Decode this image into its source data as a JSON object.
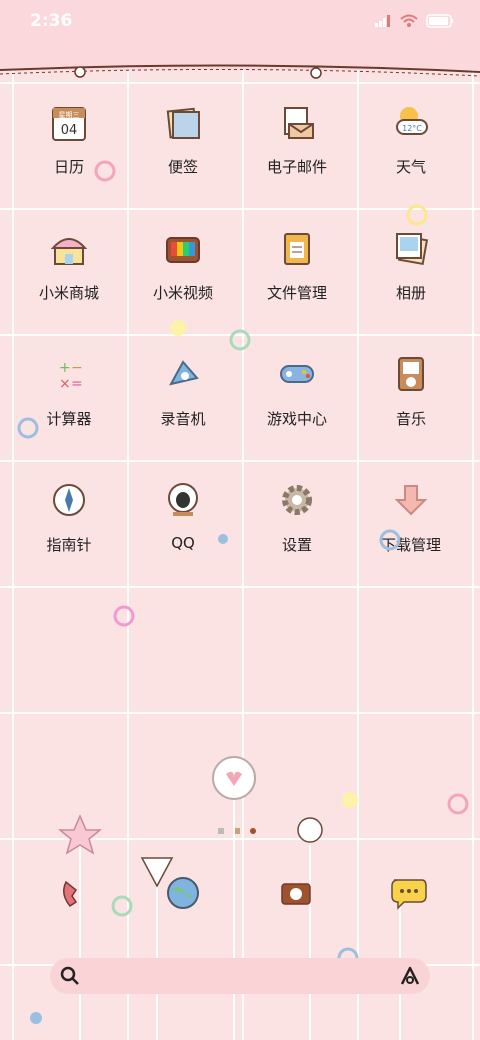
{
  "status": {
    "time": "2:36"
  },
  "apps": [
    [
      {
        "label": "日历",
        "icon": "calendar-icon"
      },
      {
        "label": "便签",
        "icon": "notes-icon"
      },
      {
        "label": "电子邮件",
        "icon": "email-icon"
      },
      {
        "label": "天气",
        "icon": "weather-icon"
      }
    ],
    [
      {
        "label": "小米商城",
        "icon": "mi-store-icon"
      },
      {
        "label": "小米视频",
        "icon": "mi-video-icon"
      },
      {
        "label": "文件管理",
        "icon": "file-manager-icon"
      },
      {
        "label": "相册",
        "icon": "gallery-icon"
      }
    ],
    [
      {
        "label": "计算器",
        "icon": "calculator-icon"
      },
      {
        "label": "录音机",
        "icon": "recorder-icon"
      },
      {
        "label": "游戏中心",
        "icon": "game-center-icon"
      },
      {
        "label": "音乐",
        "icon": "music-icon"
      }
    ],
    [
      {
        "label": "指南针",
        "icon": "compass-icon"
      },
      {
        "label": "QQ",
        "icon": "qq-icon"
      },
      {
        "label": "设置",
        "icon": "settings-icon"
      },
      {
        "label": "下载管理",
        "icon": "download-icon"
      }
    ]
  ],
  "calendar": {
    "weekday": "星期三",
    "day": "04"
  },
  "weather": {
    "temp": "12°C"
  },
  "colors": {
    "background": "#fbe2e3",
    "text": "#222222",
    "accent": "#c9a27a"
  }
}
